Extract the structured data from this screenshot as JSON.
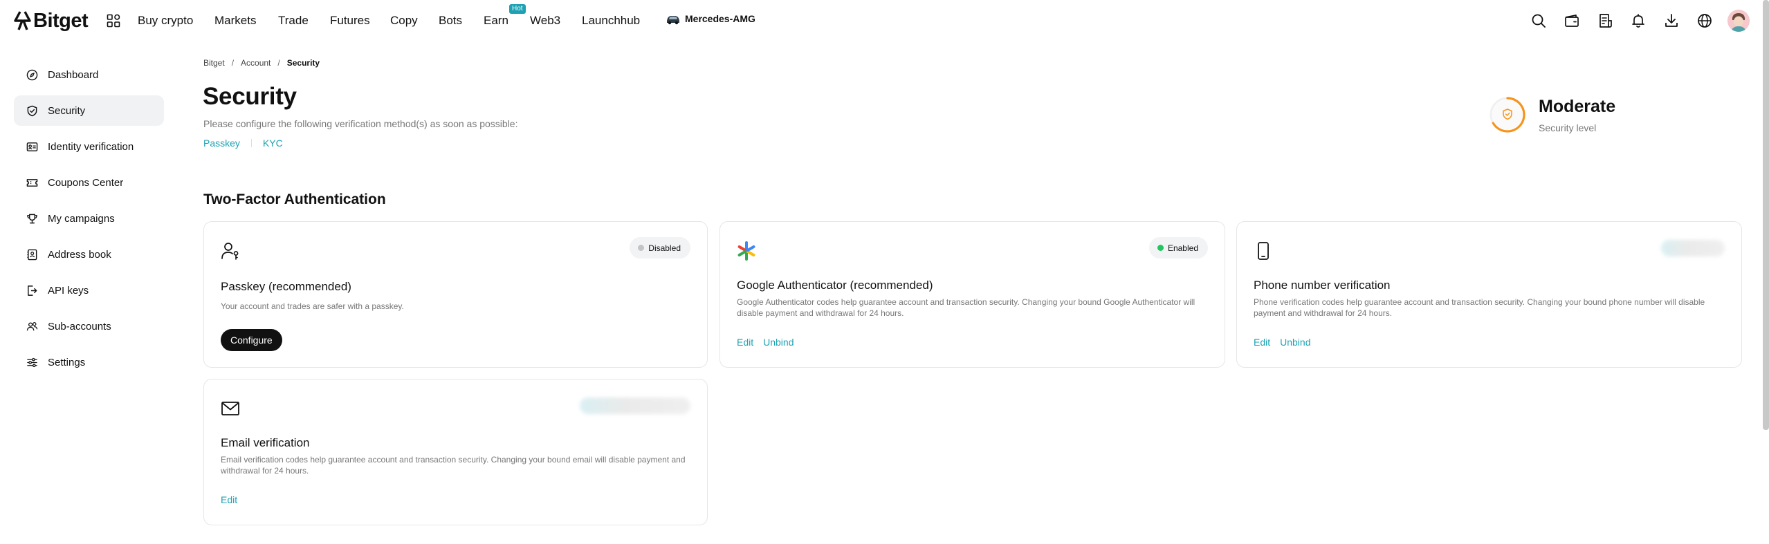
{
  "brand": {
    "name": "Bitget",
    "accent": "#1DA2B4",
    "enabled_color": "#22C55E",
    "disabled_color": "#C4C4C4"
  },
  "nav": {
    "items": [
      {
        "label": "Buy crypto"
      },
      {
        "label": "Markets"
      },
      {
        "label": "Trade"
      },
      {
        "label": "Futures"
      },
      {
        "label": "Copy"
      },
      {
        "label": "Bots"
      },
      {
        "label": "Earn"
      },
      {
        "label": "Web3"
      },
      {
        "label": "Launchhub"
      }
    ],
    "hot_badge": "Hot",
    "promo": "Mercedes-AMG",
    "icons": [
      "search-icon",
      "wallet-icon",
      "orders-icon",
      "bell-icon",
      "download-icon",
      "globe-icon"
    ]
  },
  "sidebar": {
    "items": [
      {
        "label": "Dashboard",
        "icon": "compass-icon"
      },
      {
        "label": "Security",
        "icon": "shield-icon",
        "active": true
      },
      {
        "label": "Identity verification",
        "icon": "id-card-icon"
      },
      {
        "label": "Coupons Center",
        "icon": "ticket-icon"
      },
      {
        "label": "My campaigns",
        "icon": "trophy-icon"
      },
      {
        "label": "Address book",
        "icon": "address-book-icon"
      },
      {
        "label": "API keys",
        "icon": "api-icon"
      },
      {
        "label": "Sub-accounts",
        "icon": "users-icon"
      },
      {
        "label": "Settings",
        "icon": "sliders-icon"
      }
    ]
  },
  "breadcrumb": {
    "items": [
      "Bitget",
      "Account",
      "Security"
    ],
    "separator": "/"
  },
  "page": {
    "title": "Security",
    "subtitle": "Please configure the following verification method(s) as soon as possible:",
    "quick_links": [
      "Passkey",
      "KYC"
    ]
  },
  "security_level": {
    "label": "Moderate",
    "caption": "Security level",
    "ring_color": "#F7931A"
  },
  "two_factor": {
    "title": "Two-Factor Authentication",
    "cards": [
      {
        "title": "Passkey (recommended)",
        "desc": "Your account and trades are safer with a passkey.",
        "status": "Disabled",
        "button": "Configure",
        "icon": "passkey-user-icon"
      },
      {
        "title": "Google Authenticator (recommended)",
        "desc": "Google Authenticator codes help guarantee account and transaction security. Changing your bound Google Authenticator will disable payment and withdrawal for 24 hours.",
        "status": "Enabled",
        "actions": [
          "Edit",
          "Unbind"
        ],
        "icon": "google-authenticator-icon"
      },
      {
        "title": "Phone number verification",
        "desc": "Phone verification codes help guarantee account and transaction security. Changing your bound phone number will disable payment and withdrawal for 24 hours.",
        "actions": [
          "Edit",
          "Unbind"
        ],
        "icon": "phone-icon"
      },
      {
        "title": "Email verification",
        "desc": "Email verification codes help guarantee account and transaction security. Changing your bound email will disable payment and withdrawal for 24 hours.",
        "actions": [
          "Edit"
        ],
        "icon": "envelope-icon"
      }
    ]
  }
}
